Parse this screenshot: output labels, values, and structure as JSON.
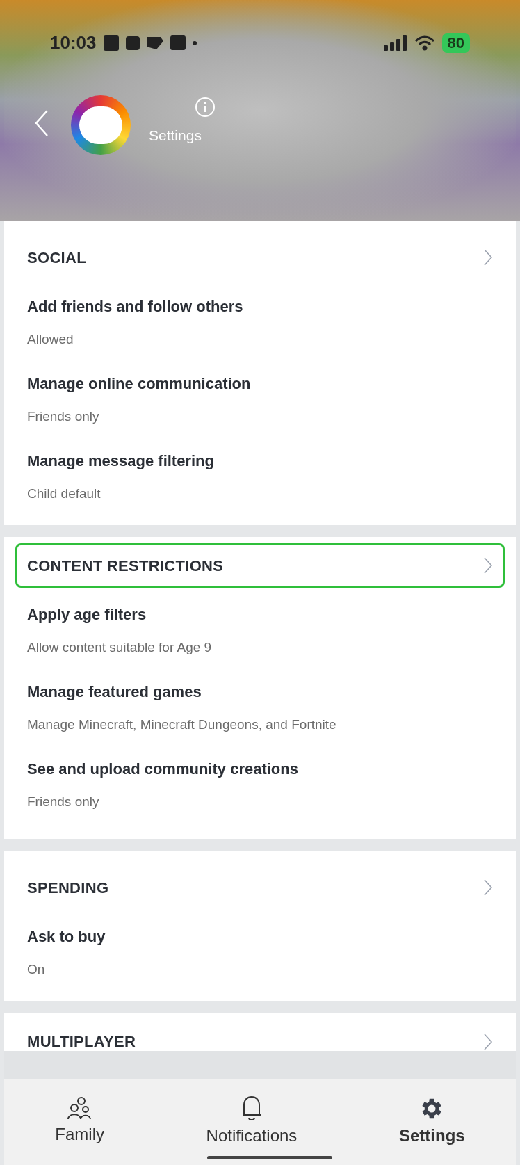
{
  "status_bar": {
    "time": "10:03",
    "battery": "80"
  },
  "header": {
    "title": "Settings"
  },
  "sections": [
    {
      "title": "SOCIAL",
      "highlighted": false,
      "items": [
        {
          "title": "Add friends and follow others",
          "value": "Allowed"
        },
        {
          "title": "Manage online communication",
          "value": "Friends only"
        },
        {
          "title": "Manage message filtering",
          "value": "Child default"
        }
      ]
    },
    {
      "title": "CONTENT RESTRICTIONS",
      "highlighted": true,
      "items": [
        {
          "title": "Apply age filters",
          "value": "Allow content suitable for Age 9"
        },
        {
          "title": "Manage featured games",
          "value": "Manage Minecraft, Minecraft Dungeons, and Fortnite"
        },
        {
          "title": "See and upload community creations",
          "value": "Friends only"
        }
      ]
    },
    {
      "title": "SPENDING",
      "highlighted": false,
      "items": [
        {
          "title": "Ask to buy",
          "value": "On"
        }
      ]
    },
    {
      "title": "MULTIPLAYER",
      "highlighted": false
    }
  ],
  "tabs": [
    {
      "label": "Family",
      "kind": "family",
      "selected": false
    },
    {
      "label": "Notifications",
      "kind": "bell",
      "selected": false
    },
    {
      "label": "Settings",
      "kind": "gear",
      "selected": true
    }
  ]
}
